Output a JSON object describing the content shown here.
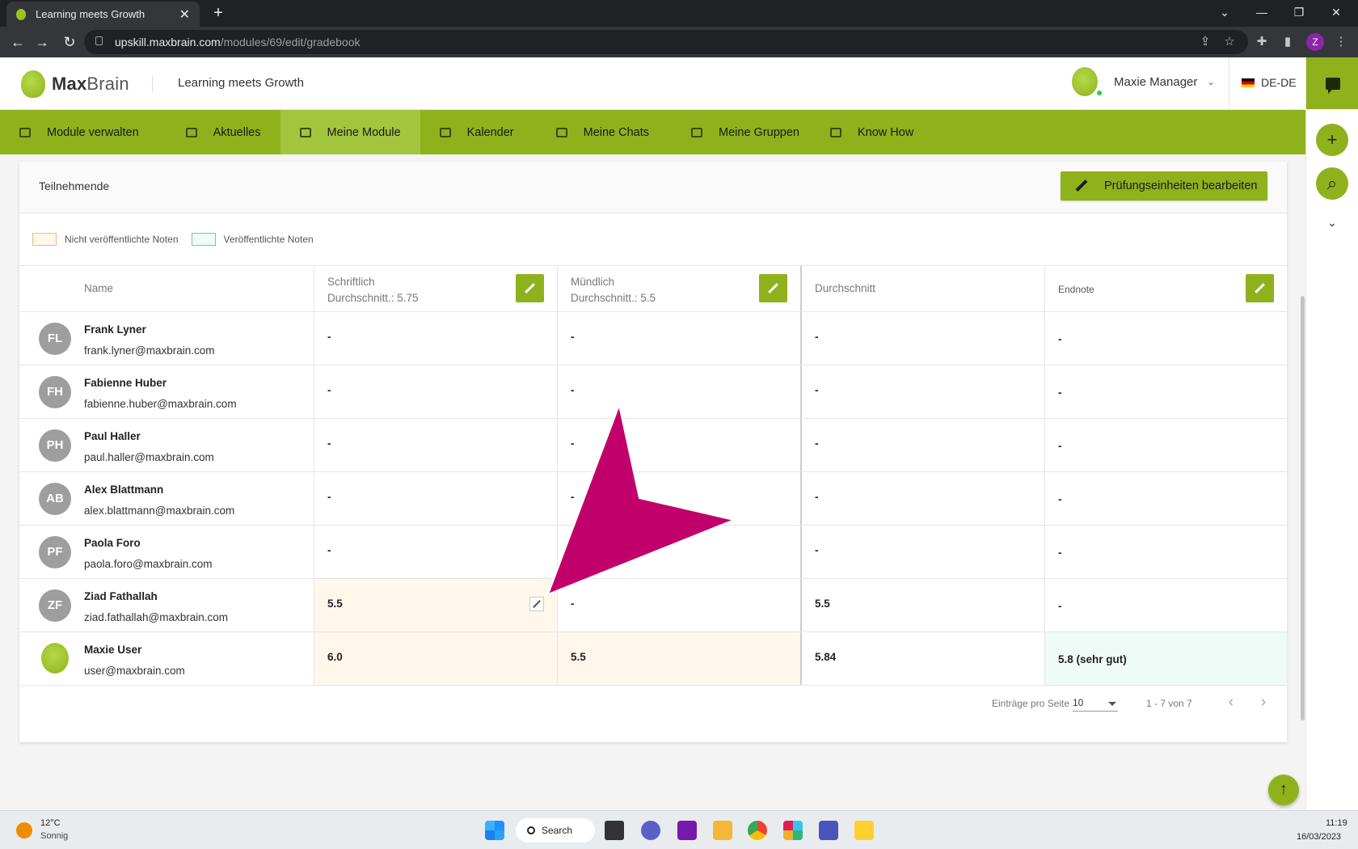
{
  "browser": {
    "tab_title": "Learning meets Growth",
    "tab_close": "✕",
    "new_tab": "+",
    "url_host": "upskill.maxbrain.com",
    "url_path": "/modules/69/edit/gradebook",
    "profile_initial": "Z"
  },
  "header": {
    "logo_max": "Max",
    "logo_brain": "Brain",
    "tagline": "Learning meets Growth",
    "user_name": "Maxie Manager",
    "language": "DE-DE"
  },
  "nav": {
    "items": [
      {
        "label": "Module verwalten",
        "active": false
      },
      {
        "label": "Aktuelles",
        "active": false
      },
      {
        "label": "Meine Module",
        "active": true
      },
      {
        "label": "Kalender",
        "active": false
      },
      {
        "label": "Meine Chats",
        "active": false
      },
      {
        "label": "Meine Gruppen",
        "active": false
      },
      {
        "label": "Know How",
        "active": false
      }
    ]
  },
  "card": {
    "title": "Teilnehmende",
    "edit_exams_label": "Prüfungseinheiten bearbeiten",
    "legend_unpublished": "Nicht veröffentlichte Noten",
    "legend_published": "Veröffentlichte Noten"
  },
  "table": {
    "columns": {
      "name": "Name",
      "written": "Schriftlich",
      "written_avg": "Durchschnitt.: 5.75",
      "oral": "Mündlich",
      "oral_avg": "Durchschnitt.: 5.5",
      "average": "Durchschnitt",
      "final": "Endnote"
    },
    "rows": [
      {
        "initials": "FL",
        "name": "Frank Lyner",
        "email": "frank.lyner@maxbrain.com",
        "written": "-",
        "oral": "-",
        "average": "-",
        "final": "-"
      },
      {
        "initials": "FH",
        "name": "Fabienne Huber",
        "email": "fabienne.huber@maxbrain.com",
        "written": "-",
        "oral": "-",
        "average": "-",
        "final": "-"
      },
      {
        "initials": "PH",
        "name": "Paul Haller",
        "email": "paul.haller@maxbrain.com",
        "written": "-",
        "oral": "-",
        "average": "-",
        "final": "-"
      },
      {
        "initials": "AB",
        "name": "Alex Blattmann",
        "email": "alex.blattmann@maxbrain.com",
        "written": "-",
        "oral": "-",
        "average": "-",
        "final": "-"
      },
      {
        "initials": "PF",
        "name": "Paola Foro",
        "email": "paola.foro@maxbrain.com",
        "written": "-",
        "oral": "-",
        "average": "-",
        "final": "-"
      },
      {
        "initials": "ZF",
        "name": "Ziad Fathallah",
        "email": "ziad.fathallah@maxbrain.com",
        "written": "5.5",
        "oral": "-",
        "average": "5.5",
        "final": "-"
      },
      {
        "initials": "",
        "name": "Maxie User",
        "email": "user@maxbrain.com",
        "written": "6.0",
        "oral": "5.5",
        "average": "5.84",
        "final": "5.8 (sehr gut)"
      }
    ]
  },
  "pager": {
    "per_page_label": "Einträge pro Seite",
    "per_page_value": "10",
    "range": "1 - 7 von 7",
    "prev": "‹",
    "next": "›"
  },
  "taskbar": {
    "temperature": "12°C",
    "weather": "Sonnig",
    "search_label": "Search",
    "time": "11:19",
    "date": "16/03/2023"
  },
  "colors": {
    "brand_green": "#8fb21c",
    "unpublished_bg": "#fff7ec",
    "published_bg": "#eefbf6",
    "annotation_arrow": "#c2006b"
  }
}
